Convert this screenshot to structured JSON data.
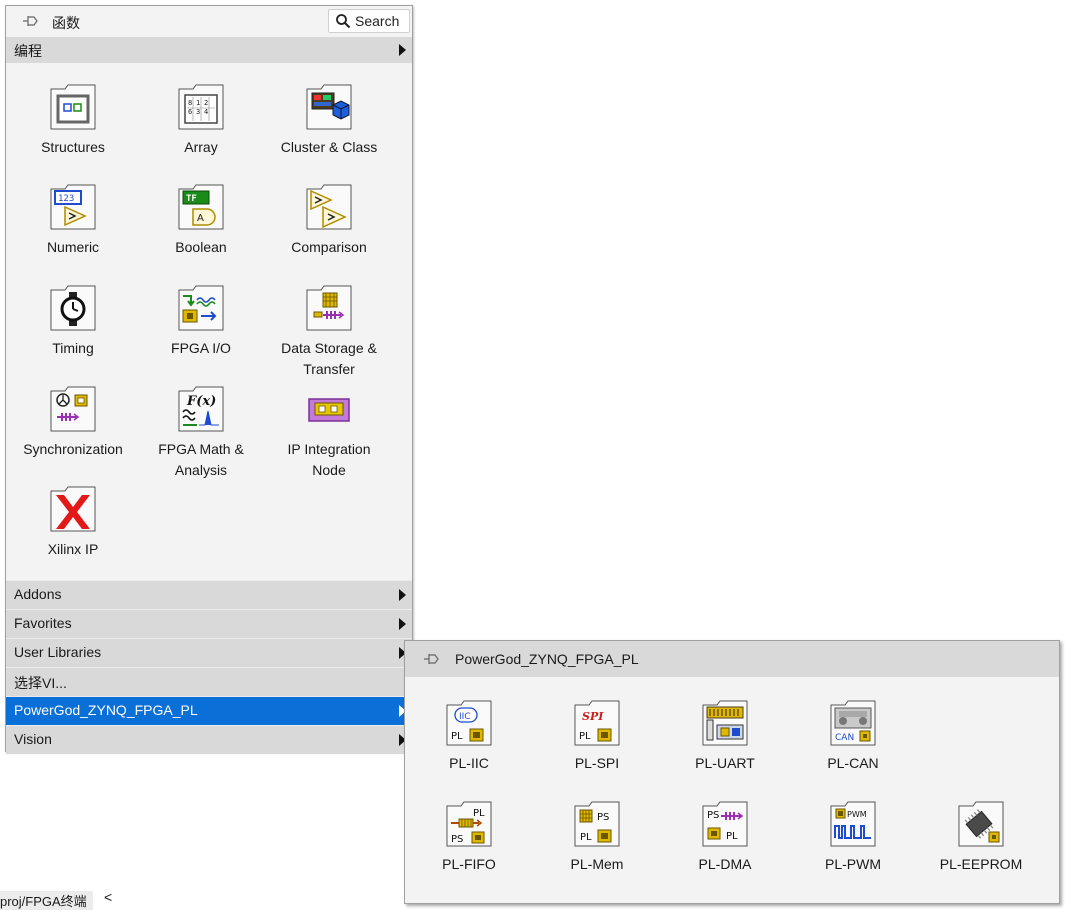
{
  "palette": {
    "title": "函数",
    "search_label": "Search",
    "category": "编程",
    "items": [
      {
        "label": "Structures",
        "icon": "structures-icon"
      },
      {
        "label": "Array",
        "icon": "array-icon"
      },
      {
        "label": "Cluster & Class",
        "icon": "cluster-class-icon"
      },
      {
        "label": "Numeric",
        "icon": "numeric-icon"
      },
      {
        "label": "Boolean",
        "icon": "boolean-icon"
      },
      {
        "label": "Comparison",
        "icon": "comparison-icon"
      },
      {
        "label": "Timing",
        "icon": "timing-icon"
      },
      {
        "label": "FPGA I/O",
        "icon": "fpga-io-icon"
      },
      {
        "label": "Data Storage & Transfer",
        "icon": "data-storage-icon"
      },
      {
        "label": "Synchronization",
        "icon": "synchronization-icon"
      },
      {
        "label": "FPGA Math & Analysis",
        "icon": "fpga-math-icon"
      },
      {
        "label": "IP Integration Node",
        "icon": "ip-integration-icon"
      },
      {
        "label": "Xilinx IP",
        "icon": "xilinx-icon"
      }
    ],
    "menu": [
      {
        "label": "Addons",
        "selected": false
      },
      {
        "label": "Favorites",
        "selected": false
      },
      {
        "label": "User Libraries",
        "selected": false
      },
      {
        "label": "选择VI...",
        "selected": false
      },
      {
        "label": "PowerGod_ZYNQ_FPGA_PL",
        "selected": true
      },
      {
        "label": "Vision",
        "selected": false
      }
    ]
  },
  "subpalette": {
    "title": "PowerGod_ZYNQ_FPGA_PL",
    "items": [
      {
        "label": "PL-IIC",
        "icon": "pl-iic-icon"
      },
      {
        "label": "PL-SPI",
        "icon": "pl-spi-icon"
      },
      {
        "label": "PL-UART",
        "icon": "pl-uart-icon"
      },
      {
        "label": "PL-CAN",
        "icon": "pl-can-icon"
      },
      {
        "label": "PL-FIFO",
        "icon": "pl-fifo-icon"
      },
      {
        "label": "PL-Mem",
        "icon": "pl-mem-icon"
      },
      {
        "label": "PL-DMA",
        "icon": "pl-dma-icon"
      },
      {
        "label": "PL-PWM",
        "icon": "pl-pwm-icon"
      },
      {
        "label": "PL-EEPROM",
        "icon": "pl-eeprom-icon"
      }
    ]
  },
  "status": {
    "path": "proj/FPGA终端",
    "scroll_arrow": "<"
  },
  "colors": {
    "selected_bg": "#0a6fd6",
    "header_bg": "#d9d9d9",
    "panel_bg": "#f3f3f3"
  }
}
